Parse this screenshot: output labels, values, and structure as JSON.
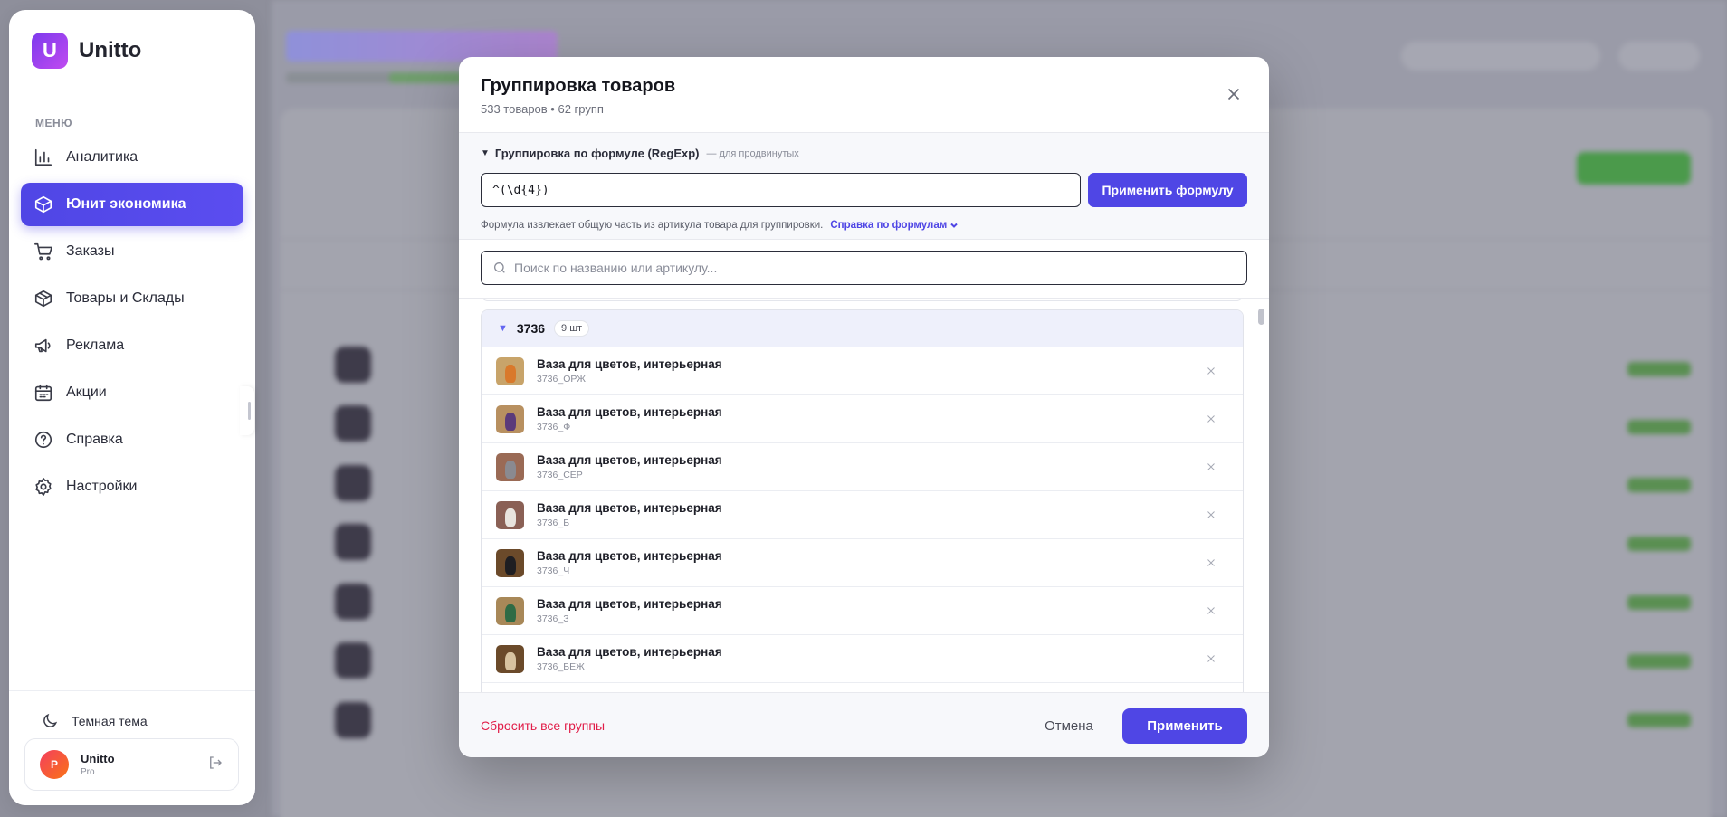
{
  "app": {
    "name": "Unitto",
    "logo_letter": "U"
  },
  "sidebar": {
    "menu_label": "МЕНЮ",
    "items": [
      {
        "label": "Аналитика",
        "icon": "bar-chart-icon",
        "active": false
      },
      {
        "label": "Юнит экономика",
        "icon": "box-icon",
        "active": true
      },
      {
        "label": "Заказы",
        "icon": "cart-icon",
        "active": false
      },
      {
        "label": "Товары и Склады",
        "icon": "package-icon",
        "active": false
      },
      {
        "label": "Реклама",
        "icon": "megaphone-icon",
        "active": false
      },
      {
        "label": "Акции",
        "icon": "calendar-icon",
        "active": false
      },
      {
        "label": "Справка",
        "icon": "help-circle-icon",
        "active": false
      },
      {
        "label": "Настройки",
        "icon": "gear-icon",
        "active": false
      }
    ],
    "theme_toggle_label": "Темная тема",
    "user": {
      "initial": "P",
      "name": "Unitto",
      "plan": "Pro"
    }
  },
  "modal": {
    "title": "Группировка товаров",
    "subtitle": "533 товаров • 62 групп",
    "formula_section": {
      "toggle_label": "Группировка по формуле (RegExp)",
      "toggle_hint": "— для продвинутых",
      "formula_value": "^(\\d{4})",
      "apply_label": "Применить формулу",
      "note": "Формула извлекает общую часть из артикула товара для группировки.",
      "help_link": "Справка по формулам"
    },
    "search": {
      "placeholder": "Поиск по названию или артикулу..."
    },
    "group": {
      "name": "3736",
      "count": "9 шт",
      "items": [
        {
          "title": "Ваза для цветов, интерьерная",
          "sku": "3736_ОРЖ",
          "vase_color": "#d9792b",
          "bg": "#c8a46a"
        },
        {
          "title": "Ваза для цветов, интерьерная",
          "sku": "3736_Ф",
          "vase_color": "#5b3a7a",
          "bg": "#b89060"
        },
        {
          "title": "Ваза для цветов, интерьерная",
          "sku": "3736_СЕР",
          "vase_color": "#8a8a90",
          "bg": "#9a6a55"
        },
        {
          "title": "Ваза для цветов, интерьерная",
          "sku": "3736_Б",
          "vase_color": "#e8e4de",
          "bg": "#8a6055"
        },
        {
          "title": "Ваза для цветов, интерьерная",
          "sku": "3736_Ч",
          "vase_color": "#1e1e22",
          "bg": "#6b4a2a"
        },
        {
          "title": "Ваза для цветов, интерьерная",
          "sku": "3736_З",
          "vase_color": "#2f6b45",
          "bg": "#a88858"
        },
        {
          "title": "Ваза для цветов, интерьерная",
          "sku": "3736_БЕЖ",
          "vase_color": "#d8c3a0",
          "bg": "#6b4a2a"
        }
      ]
    },
    "footer": {
      "reset_label": "Сбросить все группы",
      "cancel_label": "Отмена",
      "apply_label": "Применить"
    }
  }
}
